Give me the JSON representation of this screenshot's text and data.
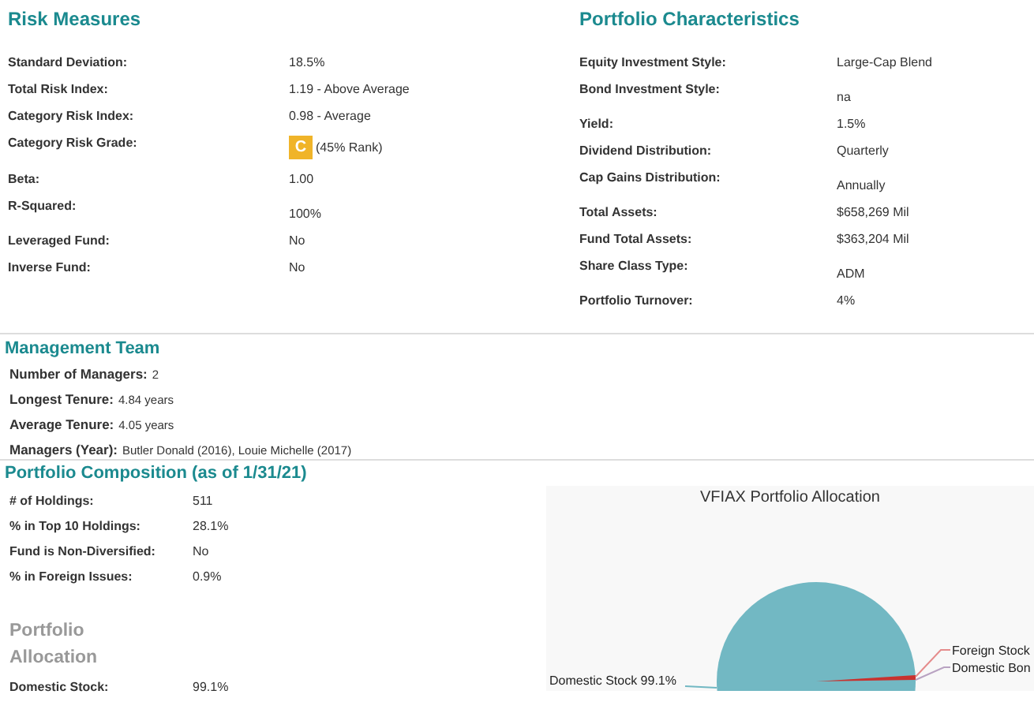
{
  "risk_measures": {
    "title": "Risk Measures",
    "rows": [
      {
        "kind": "text",
        "label": "Standard Deviation:",
        "value": "18.5%"
      },
      {
        "kind": "text",
        "label": "Total Risk Index:",
        "value": "1.19 - Above Average"
      },
      {
        "kind": "text",
        "label": "Category Risk Index:",
        "value": "0.98 - Average"
      },
      {
        "kind": "grade",
        "label": "Category Risk Grade:",
        "grade": "C",
        "value": "(45% Rank)"
      },
      {
        "kind": "text",
        "label": "Beta:",
        "value": "1.00"
      },
      {
        "kind": "tall",
        "label": "R-Squared:",
        "value": "100%"
      },
      {
        "kind": "text",
        "label": "Leveraged Fund:",
        "value": "No"
      },
      {
        "kind": "text",
        "label": "Inverse Fund:",
        "value": "No"
      }
    ]
  },
  "portfolio_characteristics": {
    "title": "Portfolio Characteristics",
    "rows": [
      {
        "kind": "text",
        "label": "Equity Investment Style:",
        "value": "Large-Cap Blend"
      },
      {
        "kind": "tall",
        "label": "Bond Investment Style:",
        "value": "na"
      },
      {
        "kind": "text",
        "label": "Yield:",
        "value": "1.5%"
      },
      {
        "kind": "text",
        "label": "Dividend Distribution:",
        "value": "Quarterly"
      },
      {
        "kind": "tall",
        "label": "Cap Gains Distribution:",
        "value": "Annually"
      },
      {
        "kind": "text",
        "label": "Total Assets:",
        "value": "$658,269 Mil"
      },
      {
        "kind": "text",
        "label": "Fund Total Assets:",
        "value": "$363,204 Mil"
      },
      {
        "kind": "tall",
        "label": "Share Class Type:",
        "value": "ADM"
      },
      {
        "kind": "text",
        "label": "Portfolio Turnover:",
        "value": "4%"
      }
    ]
  },
  "management_team": {
    "title": "Management Team",
    "rows": [
      {
        "label": "Number of Managers:",
        "value": "2"
      },
      {
        "label": "Longest Tenure:",
        "value": "4.84 years"
      },
      {
        "label": "Average Tenure:",
        "value": "4.05 years"
      },
      {
        "label": "Managers (Year):",
        "value": "Butler Donald (2016), Louie Michelle (2017)"
      }
    ]
  },
  "portfolio_composition": {
    "title": "Portfolio Composition (as of 1/31/21)",
    "rows": [
      {
        "label": "# of Holdings:",
        "value": "511"
      },
      {
        "label": "% in Top 10 Holdings:",
        "value": "28.1%"
      },
      {
        "label": "Fund is Non-Diversified:",
        "value": "No"
      },
      {
        "label": "% in Foreign Issues:",
        "value": "0.9%"
      }
    ],
    "allocation_title": [
      "Portfolio",
      "Allocation"
    ],
    "allocation_rows": [
      {
        "label": "Domestic Stock:",
        "value": "99.1%"
      }
    ]
  },
  "allocation_chart": {
    "title": "VFIAX Portfolio Allocation",
    "labels": [
      "Domestic Stock 99.1%",
      "Foreign Stock",
      "Domestic Bon"
    ]
  }
}
